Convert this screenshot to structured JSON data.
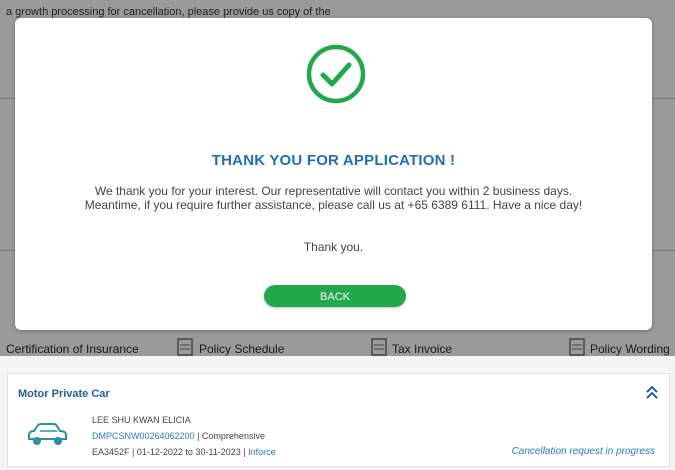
{
  "background": {
    "top_text": "a growth processing for cancellation, please provide us copy of the",
    "doc_links": [
      "Certification of Insurance",
      "Policy Schedule",
      "Tax Invoice",
      "Policy Wording"
    ]
  },
  "modal": {
    "title": "THANK YOU FOR APPLICATION !",
    "message_line1": "We thank you for your interest. Our representative will contact you within 2 business days.",
    "message_line2": "Meantime, if you require further assistance, please call us at +65 6389 6111. Have a nice day!",
    "thanks": "Thank you.",
    "back_label": "BACK",
    "icon": "check-circle-icon",
    "accent_color": "#22a84a"
  },
  "policy_card": {
    "title": "Motor Private Car",
    "holder": "LEE SHU KWAN ELICIA",
    "policy_number": "DMPCSNW00264062200",
    "plan": "Comprehensive",
    "vehicle": "EA3452F",
    "period": "01-12-2022 to 30-11-2023",
    "state": "Inforce",
    "status": "Cancellation request in progress"
  }
}
